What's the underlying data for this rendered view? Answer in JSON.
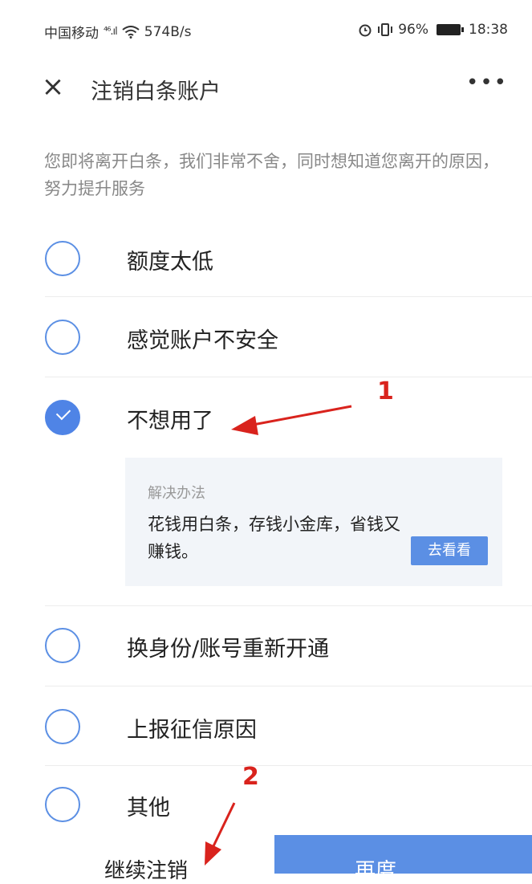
{
  "status_bar": {
    "carrier": "中国移动",
    "signal": "⁴⁶.ıl",
    "speed": "574B/s",
    "battery_pct": "96%",
    "time": "18:38"
  },
  "nav": {
    "title": "注销白条账户",
    "close_icon": "×",
    "more_icon": "•••"
  },
  "intro": "您即将离开白条，我们非常不舍，同时想知道您离开的原因，努力提升服务",
  "options": [
    {
      "label": "额度太低",
      "checked": false
    },
    {
      "label": "感觉账户不安全",
      "checked": false
    },
    {
      "label": "不想用了",
      "checked": true
    },
    {
      "label": "换身份/账号重新开通",
      "checked": false
    },
    {
      "label": "上报征信原因",
      "checked": false
    },
    {
      "label": "其他",
      "checked": false
    }
  ],
  "solution": {
    "title": "解决办法",
    "body": "花钱用白条，存钱小金库，省钱又赚钱。",
    "button": "去看看"
  },
  "annotations": {
    "one": "1",
    "two": "2"
  },
  "bottom": {
    "continue_label": "继续注销",
    "primary_label": "再度"
  },
  "colors": {
    "accent": "#5b8fe4",
    "annotation": "#d9231d"
  }
}
